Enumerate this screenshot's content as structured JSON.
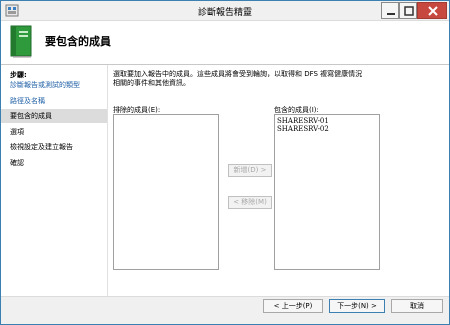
{
  "window": {
    "title": "診斷報告精靈",
    "controls": {
      "minimize": "minimize",
      "maximize": "maximize",
      "close": "close"
    }
  },
  "header": {
    "title": "要包含的成員"
  },
  "nav": {
    "heading": "步驟:",
    "items": [
      {
        "label": "診斷報告或測試的類型",
        "state": "link"
      },
      {
        "label": "路徑及名稱",
        "state": "link"
      },
      {
        "label": "要包含的成員",
        "state": "active"
      },
      {
        "label": "選項",
        "state": "plain"
      },
      {
        "label": "檢視設定及建立報告",
        "state": "plain"
      },
      {
        "label": "確認",
        "state": "plain"
      }
    ]
  },
  "main": {
    "description": "選取要加入報告中的成員。這些成員將會受到輪詢，以取得和 DFS 複寫健康情況相關的事件和其他資訊。",
    "excluded_label": "排除的成員(E):",
    "included_label": "包含的成員(I):",
    "excluded_members": [],
    "included_members": [
      "SHARESRV-01",
      "SHARESRV-02"
    ],
    "add_button": "新增(D) >",
    "remove_button": "< 移除(M)"
  },
  "footer": {
    "back_button": "< 上一步(P)",
    "next_button": "下一步(N) >",
    "cancel_button": "取消"
  },
  "colors": {
    "link": "#1f5fa6",
    "active_nav_bg": "#dcdcdc",
    "close_button": "#c7483e",
    "accent_border": "#3c7fb1"
  },
  "icons": {
    "app": "dfs-management-icon",
    "wizard": "green-book-icon"
  }
}
